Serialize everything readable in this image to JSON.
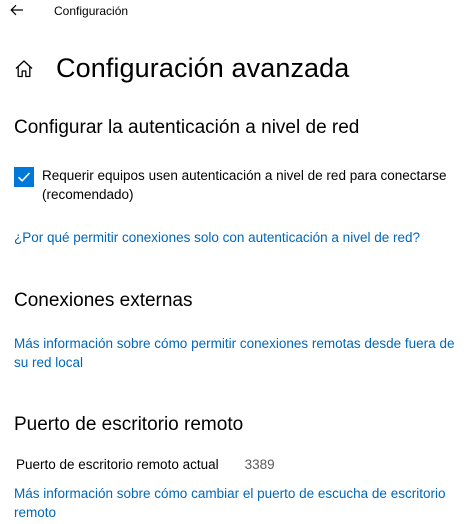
{
  "app": {
    "title": "Configuración"
  },
  "header": {
    "title": "Configuración avanzada"
  },
  "nla": {
    "heading": "Configurar la autenticación a nivel de red",
    "checkbox_label": "Requerir equipos usen autenticación a nivel de red para conectarse (recomendado)",
    "checkbox_checked": true,
    "link": "¿Por qué permitir conexiones solo con autenticación a nivel de red?"
  },
  "external": {
    "heading": "Conexiones externas",
    "link": "Más información sobre cómo permitir conexiones remotas desde fuera de su red local"
  },
  "port": {
    "heading": "Puerto de escritorio remoto",
    "label": "Puerto de escritorio remoto actual",
    "value": "3389",
    "link": "Más información sobre cómo cambiar el puerto de escucha de escritorio remoto"
  },
  "colors": {
    "accent": "#0078d7",
    "link": "#0067b8"
  },
  "icons": {
    "back": "back-arrow-icon",
    "home": "home-icon",
    "check": "checkmark-icon"
  }
}
